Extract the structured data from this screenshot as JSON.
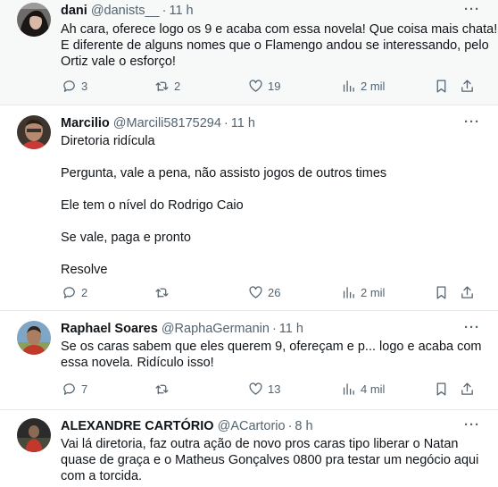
{
  "tweets": [
    {
      "name": "dani",
      "handle": "@danists__",
      "separator": "·",
      "time": "11 h",
      "more": "···",
      "lines": [
        "Ah cara, oferece logo os 9 e acaba com essa novela! Que coisa mais chata!",
        "E diferente de alguns nomes que o Flamengo andou se interessando, pelo",
        "Ortiz vale o esforço!"
      ],
      "replies": "3",
      "retweets": "2",
      "likes": "19",
      "views": "2 mil"
    },
    {
      "name": "Marcilio",
      "handle": "@Marcili58175294",
      "separator": "·",
      "time": "11 h",
      "more": "···",
      "paragraphs": [
        "Diretoria ridícula",
        "Pergunta, vale a pena, não assisto jogos de outros times",
        "Ele tem o nível do Rodrigo Caio",
        "Se vale, paga e pronto",
        "Resolve"
      ],
      "replies": "2",
      "retweets": "",
      "likes": "26",
      "views": "2 mil"
    },
    {
      "name": "Raphael Soares",
      "handle": "@RaphaGermanin",
      "separator": "·",
      "time": "11 h",
      "more": "···",
      "lines": [
        "Se os caras sabem que eles querem 9, ofereçam e p... logo e acaba com",
        "essa novela. Ridículo isso!"
      ],
      "replies": "7",
      "retweets": "",
      "likes": "13",
      "views": "4 mil"
    },
    {
      "name": "ALEXANDRE CARTÓRIO",
      "handle": "@ACartorio",
      "separator": "·",
      "time": "8 h",
      "more": "···",
      "lines": [
        "Vai lá diretoria, faz outra ação de novo pros caras tipo liberar o Natan",
        "quase de graça e o Matheus Gonçalves 0800 pra testar um negócio aqui",
        "com a torcida."
      ]
    }
  ],
  "icons": {
    "reply": "reply-icon",
    "retweet": "retweet-icon",
    "like": "heart-icon",
    "views": "views-icon",
    "bookmark": "bookmark-icon",
    "share": "share-icon"
  },
  "colors": {
    "text": "#0f1419",
    "muted": "#536471",
    "highlight_bg": "#f7f8f8",
    "divider": "#e6e9ec"
  }
}
